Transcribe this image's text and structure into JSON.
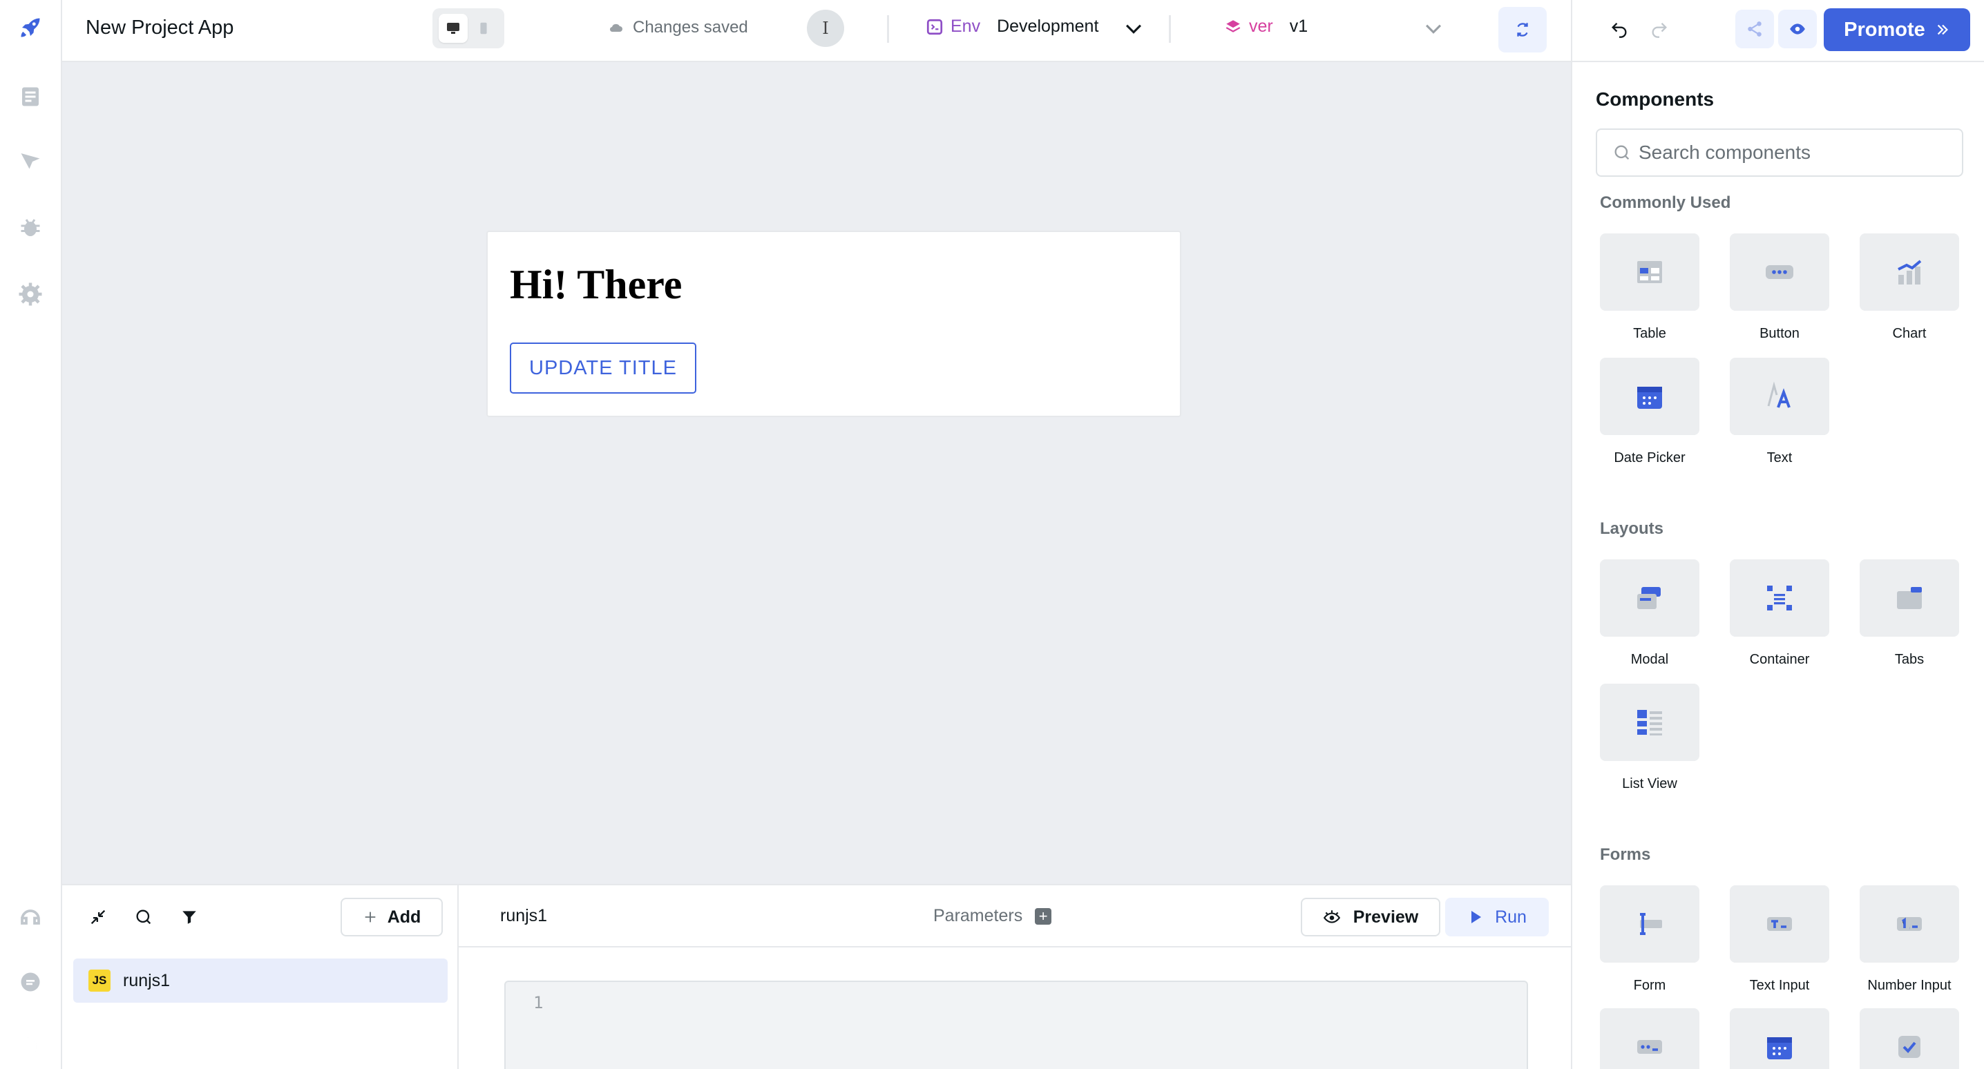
{
  "header": {
    "app_name": "New Project App",
    "save_status": "Changes saved",
    "avatar_initial": "I",
    "env_label": "Env",
    "env_value": "Development",
    "version_label": "ver",
    "version_value": "v1",
    "promote_label": "Promote"
  },
  "canvas": {
    "heading": "Hi! There",
    "button_label": "UPDATE TITLE"
  },
  "queries": {
    "add_label": "Add",
    "items": [
      {
        "name": "runjs1",
        "badge": "JS"
      }
    ],
    "selected_name": "runjs1",
    "parameters_label": "Parameters",
    "preview_label": "Preview",
    "run_label": "Run",
    "editor_line": "1"
  },
  "components": {
    "title": "Components",
    "search_placeholder": "Search components",
    "sections": [
      {
        "name": "Commonly Used",
        "items": [
          "Table",
          "Button",
          "Chart",
          "Date Picker",
          "Text"
        ]
      },
      {
        "name": "Layouts",
        "items": [
          "Modal",
          "Container",
          "Tabs",
          "List View"
        ]
      },
      {
        "name": "Forms",
        "items": [
          "Form",
          "Text Input",
          "Number Input"
        ]
      }
    ]
  },
  "colors": {
    "accent": "#3e63dd",
    "env": "#8e4ec6",
    "version": "#d6409f",
    "canvas_bg": "#eceef2"
  }
}
